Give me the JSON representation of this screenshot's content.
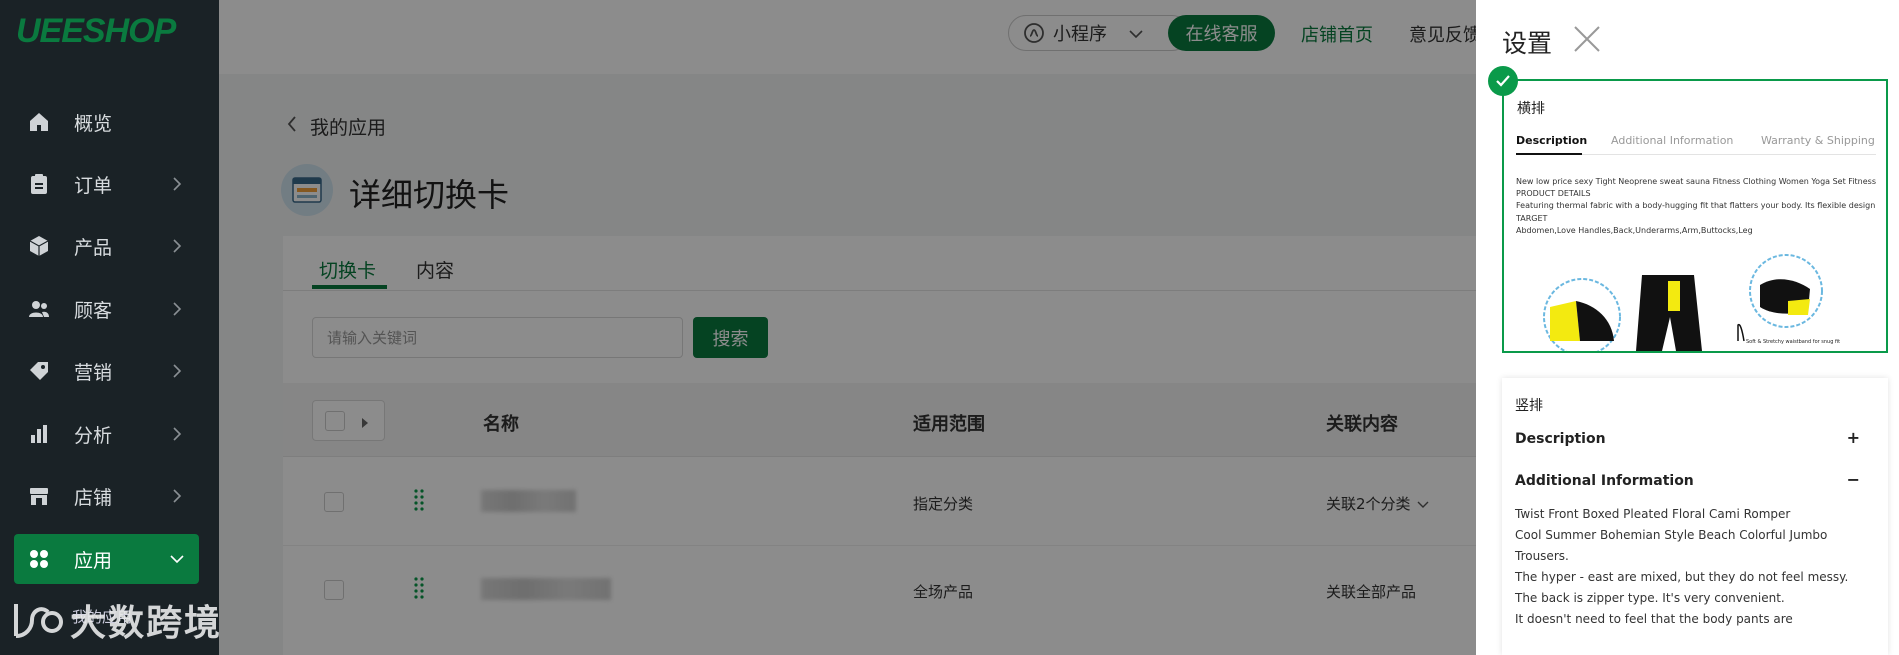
{
  "brand": {
    "logo": "UEESHOP"
  },
  "sidebar": {
    "items": [
      {
        "label": "概览",
        "icon": "home-icon",
        "has_children": false
      },
      {
        "label": "订单",
        "icon": "clipboard-icon",
        "has_children": true
      },
      {
        "label": "产品",
        "icon": "box-icon",
        "has_children": true
      },
      {
        "label": "顾客",
        "icon": "users-icon",
        "has_children": true
      },
      {
        "label": "营销",
        "icon": "tag-icon",
        "has_children": true
      },
      {
        "label": "分析",
        "icon": "bar-chart-icon",
        "has_children": true
      },
      {
        "label": "店铺",
        "icon": "store-icon",
        "has_children": true
      },
      {
        "label": "应用",
        "icon": "apps-grid-icon",
        "has_children": true,
        "active": true
      }
    ],
    "sub_item": "我的应用"
  },
  "watermark": {
    "text": "大数跨境"
  },
  "topbar": {
    "mini_program": "小程序",
    "online_service": "在线客服",
    "store_home": "店铺首页",
    "feedback": "意见反馈"
  },
  "breadcrumb": {
    "back_label": "我的应用"
  },
  "page": {
    "title": "详细切换卡"
  },
  "tabs": [
    {
      "label": "切换卡",
      "active": true
    },
    {
      "label": "内容",
      "active": false
    }
  ],
  "search": {
    "placeholder": "请输入关键词",
    "button": "搜索"
  },
  "table": {
    "columns": [
      "名称",
      "适用范围",
      "关联内容"
    ],
    "rows": [
      {
        "scope": "指定分类",
        "related": "关联2个分类"
      },
      {
        "scope": "全场产品",
        "related": "关联全部产品"
      }
    ]
  },
  "drawer": {
    "title": "设置",
    "layout_horizontal": {
      "label": "横排",
      "preview_tabs": [
        "Description",
        "Additional Information",
        "Warranty & Shipping"
      ],
      "preview_lines": [
        "New low price sexy Tight Neoprene sweat sauna Fitness Clothing Women Yoga Set Fitness Set Women",
        "PRODUCT DETAILS",
        "Featuring thermal fabric with a body-hugging fit that flatters your body. Its flexible design brings perfect",
        "TARGET",
        " Abdomen,Love Handles,Back,Underarms,Arm,Buttocks,Leg"
      ],
      "preview_caption": "Soft & Stretchy waistband for snug fit"
    },
    "layout_vertical": {
      "label": "竖排",
      "sections": [
        {
          "title": "Description",
          "sign": "+"
        },
        {
          "title": "Additional Information",
          "sign": "−"
        }
      ],
      "lines": [
        "Twist Front Boxed Pleated Floral Cami Romper",
        "Cool Summer Bohemian Style Beach Colorful Jumbo",
        "Trousers.",
        "The hyper - east  are mixed, but they do not feel messy.",
        "The back is zipper type. It's very convenient.",
        "It doesn't need to feel that the body pants are"
      ]
    }
  },
  "colors": {
    "accent": "#0a7a3f",
    "sidebar_bg": "#1a2226",
    "selected_border": "#0a9a4a"
  }
}
